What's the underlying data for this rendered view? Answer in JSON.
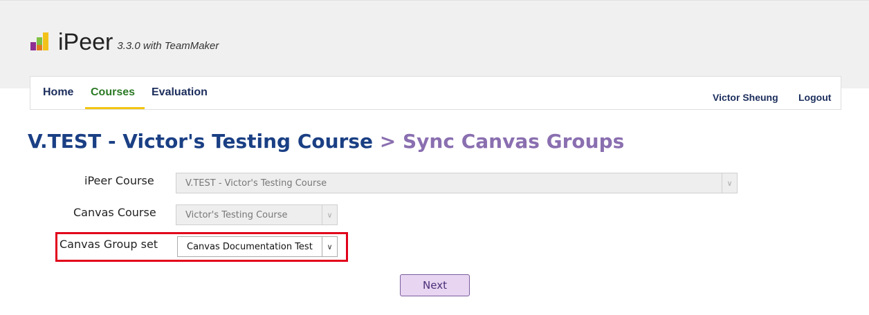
{
  "app": {
    "name": "iPeer",
    "version": "3.3.0 with TeamMaker"
  },
  "nav": {
    "items": [
      {
        "label": "Home"
      },
      {
        "label": "Courses"
      },
      {
        "label": "Evaluation"
      }
    ],
    "active": "Courses",
    "user_name": "Victor Sheung",
    "logout_label": "Logout"
  },
  "title": {
    "course": "V.TEST - Victor's Testing Course",
    "separator": ">",
    "section": "Sync Canvas Groups"
  },
  "form": {
    "ipeer_course": {
      "label": "iPeer Course",
      "value": "V.TEST - Victor's Testing Course"
    },
    "canvas_course": {
      "label": "Canvas Course",
      "value": "Victor's Testing Course"
    },
    "canvas_group_set": {
      "label": "Canvas Group set",
      "value": "Canvas Documentation Test"
    },
    "next_label": "Next"
  },
  "colors": {
    "nav_text": "#1b2d5c",
    "nav_active": "#2c7a26",
    "nav_underline": "#f2c511",
    "title_course": "#1a3f84",
    "title_section": "#8a6fb0",
    "highlight_border": "#e1001a",
    "button_bg": "#e7d5f1"
  },
  "icons": {
    "logo": "bar-blocks-logo-icon",
    "dropdown": "chevron-down-icon"
  }
}
